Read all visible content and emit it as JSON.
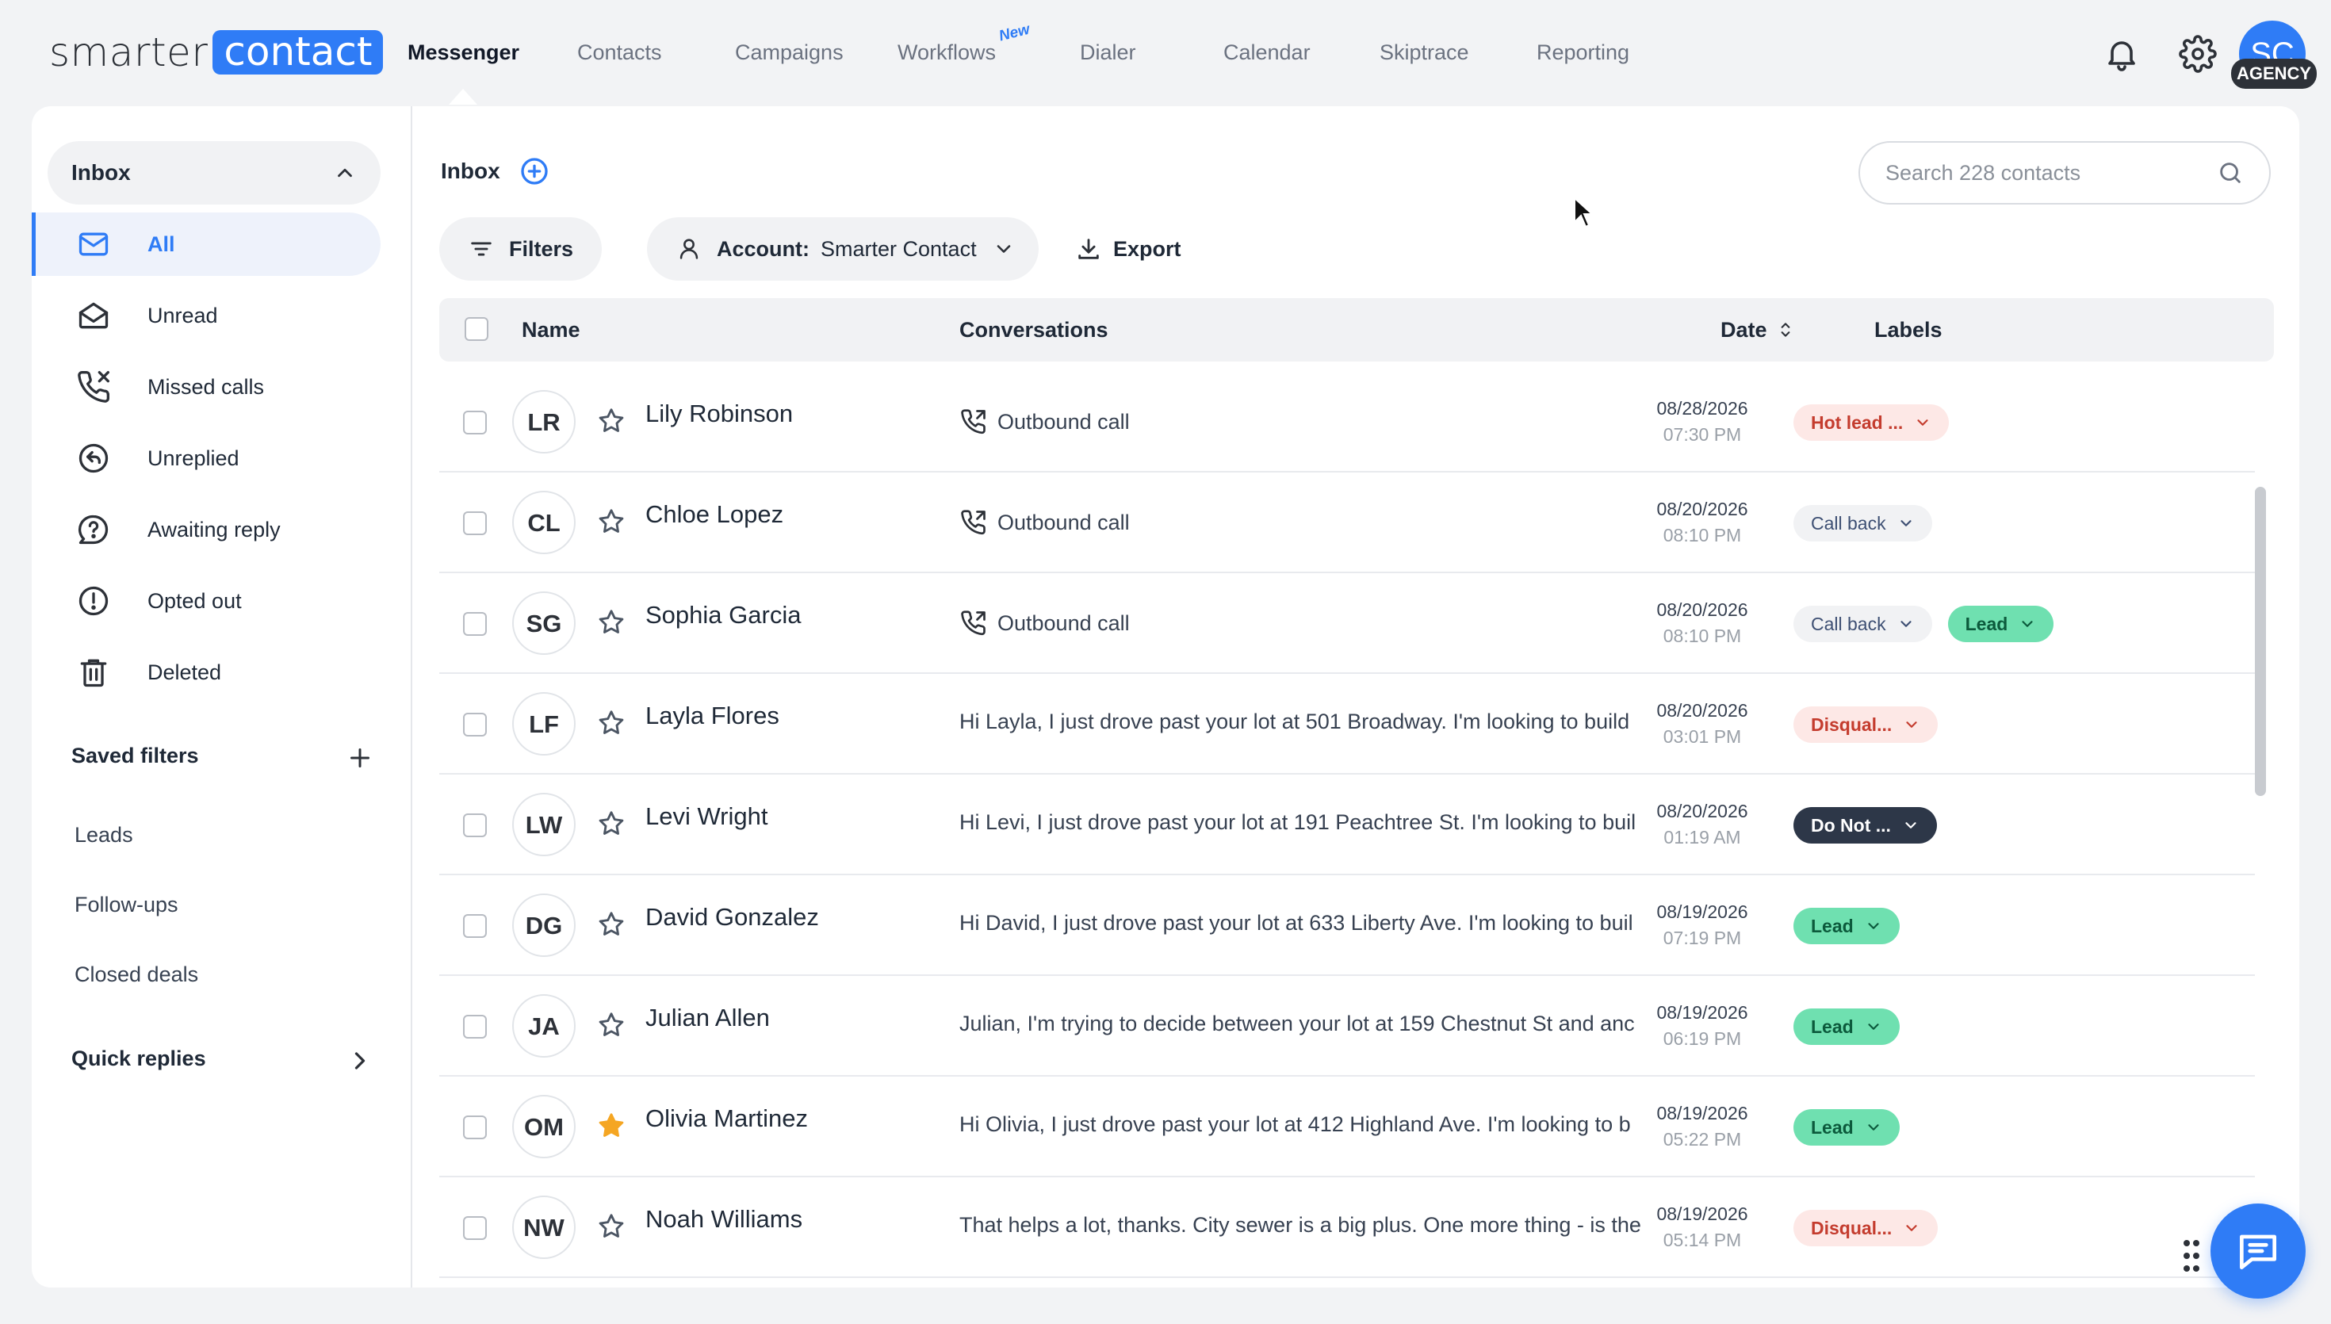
{
  "brand": {
    "logo_word1": "smarter",
    "logo_word2": "contact",
    "accent": "#2f7cf6"
  },
  "nav": {
    "items": [
      {
        "label": "Messenger",
        "active": true
      },
      {
        "label": "Contacts"
      },
      {
        "label": "Campaigns"
      },
      {
        "label": "Workflows",
        "badge": "New"
      },
      {
        "label": "Dialer"
      },
      {
        "label": "Calendar"
      },
      {
        "label": "Skiptrace"
      },
      {
        "label": "Reporting"
      }
    ]
  },
  "user": {
    "initials": "SC",
    "plan_badge": "AGENCY"
  },
  "sidebar": {
    "inbox_label": "Inbox",
    "items": [
      {
        "label": "All",
        "icon": "mail-icon",
        "active": true
      },
      {
        "label": "Unread",
        "icon": "envelope-open-icon"
      },
      {
        "label": "Missed calls",
        "icon": "missed-call-icon"
      },
      {
        "label": "Unreplied",
        "icon": "reply-icon"
      },
      {
        "label": "Awaiting reply",
        "icon": "question-bubble-icon"
      },
      {
        "label": "Opted out",
        "icon": "alert-circle-icon"
      },
      {
        "label": "Deleted",
        "icon": "trash-icon"
      }
    ],
    "saved_filters_label": "Saved filters",
    "saved_filters": [
      "Leads",
      "Follow-ups",
      "Closed deals"
    ],
    "quick_replies_label": "Quick replies"
  },
  "content": {
    "title": "Inbox",
    "search_placeholder": "Search 228 contacts",
    "filters_label": "Filters",
    "account_label": "Account:",
    "account_value": "Smarter Contact",
    "export_label": "Export",
    "columns": {
      "name": "Name",
      "conversations": "Conversations",
      "date": "Date",
      "labels": "Labels"
    }
  },
  "rows": [
    {
      "initials": "LR",
      "name": "Lily Robinson",
      "starred": false,
      "conv": "Outbound call",
      "call": true,
      "date": "08/28/2026",
      "time": "07:30 PM",
      "labels": [
        {
          "text": "Hot lead ...",
          "kind": "hot"
        }
      ]
    },
    {
      "initials": "CL",
      "name": "Chloe Lopez",
      "starred": false,
      "conv": "Outbound call",
      "call": true,
      "date": "08/20/2026",
      "time": "08:10 PM",
      "labels": [
        {
          "text": "Call back",
          "kind": "call"
        }
      ]
    },
    {
      "initials": "SG",
      "name": "Sophia Garcia",
      "starred": false,
      "conv": "Outbound call",
      "call": true,
      "date": "08/20/2026",
      "time": "08:10 PM",
      "labels": [
        {
          "text": "Call back",
          "kind": "call"
        },
        {
          "text": "Lead",
          "kind": "lead"
        }
      ]
    },
    {
      "initials": "LF",
      "name": "Layla Flores",
      "starred": false,
      "conv": "Hi Layla, I just drove past your lot at 501 Broadway. I'm looking to build",
      "call": false,
      "date": "08/20/2026",
      "time": "03:01 PM",
      "labels": [
        {
          "text": "Disqual...",
          "kind": "dis"
        }
      ]
    },
    {
      "initials": "LW",
      "name": "Levi Wright",
      "starred": false,
      "conv": "Hi Levi, I just drove past your lot at 191 Peachtree St. I'm looking to buil",
      "call": false,
      "date": "08/20/2026",
      "time": "01:19 AM",
      "labels": [
        {
          "text": "Do Not ...",
          "kind": "dnc"
        }
      ]
    },
    {
      "initials": "DG",
      "name": "David Gonzalez",
      "starred": false,
      "conv": "Hi David, I just drove past your lot at 633 Liberty Ave. I'm looking to buil",
      "call": false,
      "date": "08/19/2026",
      "time": "07:19 PM",
      "labels": [
        {
          "text": "Lead",
          "kind": "lead"
        }
      ]
    },
    {
      "initials": "JA",
      "name": "Julian Allen",
      "starred": false,
      "conv": "Julian, I'm trying to decide between your lot at 159 Chestnut St and anc",
      "call": false,
      "date": "08/19/2026",
      "time": "06:19 PM",
      "labels": [
        {
          "text": "Lead",
          "kind": "lead"
        }
      ]
    },
    {
      "initials": "OM",
      "name": "Olivia Martinez",
      "starred": true,
      "conv": "Hi Olivia, I just drove past your lot at 412 Highland Ave. I'm looking to b",
      "call": false,
      "date": "08/19/2026",
      "time": "05:22 PM",
      "labels": [
        {
          "text": "Lead",
          "kind": "lead"
        }
      ]
    },
    {
      "initials": "NW",
      "name": "Noah Williams",
      "starred": false,
      "conv": "That helps a lot, thanks. City sewer is a big plus. One more thing - is the",
      "call": false,
      "date": "08/19/2026",
      "time": "05:14 PM",
      "labels": [
        {
          "text": "Disqual...",
          "kind": "dis"
        }
      ]
    }
  ]
}
